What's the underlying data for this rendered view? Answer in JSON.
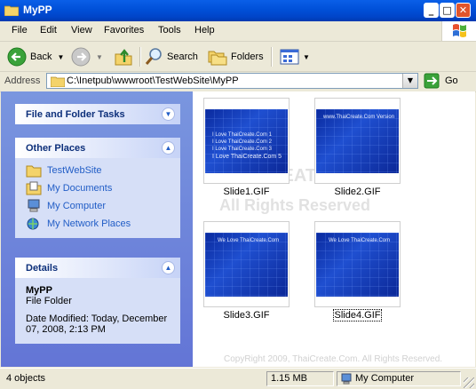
{
  "window": {
    "title": "MyPP",
    "minimize_glyph": "_",
    "maximize_glyph": "□",
    "close_glyph": "✕"
  },
  "menu": [
    "File",
    "Edit",
    "View",
    "Favorites",
    "Tools",
    "Help"
  ],
  "toolbar": {
    "back_label": "Back",
    "search_label": "Search",
    "folders_label": "Folders"
  },
  "address": {
    "label": "Address",
    "value": "C:\\Inetpub\\wwwroot\\TestWebSite\\MyPP",
    "go_label": "Go"
  },
  "tasks": {
    "file_folder": {
      "title": "File and Folder Tasks"
    },
    "other_places": {
      "title": "Other Places",
      "items": [
        "TestWebSite",
        "My Documents",
        "My Computer",
        "My Network Places"
      ]
    },
    "details": {
      "title": "Details",
      "name": "MyPP",
      "type": "File Folder",
      "modified_line1": "Date Modified: Today, December",
      "modified_line2": "07, 2008, 2:13 PM"
    }
  },
  "files": [
    {
      "name": "Slide1.GIF",
      "lines": [
        "I Love ThaiCreate.Com 1",
        "I Love ThaiCreate.Com 2",
        "I Love ThaiCreate.Com 3",
        "I Love ThaiCreate.Com 5"
      ]
    },
    {
      "name": "Slide2.GIF",
      "lines": [
        "www.ThaiCreate.Com Version"
      ]
    },
    {
      "name": "Slide3.GIF",
      "lines": [
        "We Love ThaiCreate.Com"
      ]
    },
    {
      "name": "Slide4.GIF",
      "lines": [
        "We Love ThaiCreate.Com"
      ]
    }
  ],
  "watermark": {
    "big1": "THAICREATE.COM",
    "big2": "All Rights Reserved",
    "copyright": "CopyRight 2009, ThaiCreate.Com. All Rights Reserved."
  },
  "status": {
    "objects": "4 objects",
    "size": "1.15 MB",
    "zone": "My Computer"
  },
  "colors": {
    "titlebar": "#0050d8",
    "link": "#215dc6",
    "task_pane": "#6375d6"
  }
}
